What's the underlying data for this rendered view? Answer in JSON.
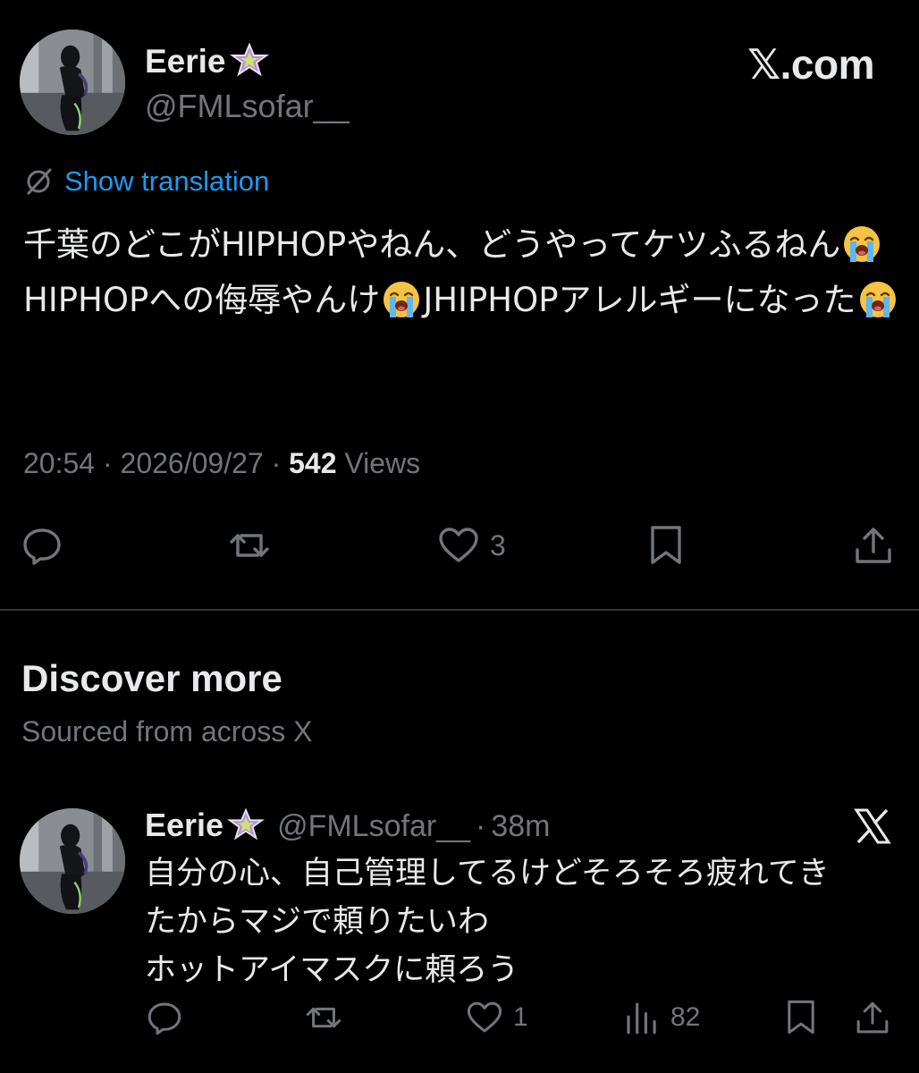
{
  "post": {
    "author": {
      "display_name": "Eerie",
      "handle": "@FMLsofar__",
      "badge_icon": "star-icon"
    },
    "brand_watermark": "𝕏.com",
    "translate": {
      "icon": "no-translation-icon",
      "label": "Show translation"
    },
    "text_segments": [
      {
        "text": "千葉のどこがHIPHOPやねん、どうやってケツふるねん"
      },
      {
        "emoji": "loudly-crying-face"
      },
      {
        "text": "HIPHOPへの侮辱やんけ"
      },
      {
        "emoji": "loudly-crying-face"
      },
      {
        "text": "JHIPHOPアレルギーになった"
      },
      {
        "emoji": "loudly-crying-face"
      }
    ],
    "time": "20:54",
    "date": "2026/09/27",
    "separator": "·",
    "views_count": "542",
    "views_label": "Views",
    "actions": {
      "reply": {
        "icon": "reply-icon"
      },
      "repost": {
        "icon": "repost-icon"
      },
      "like": {
        "icon": "heart-icon",
        "count": "3"
      },
      "bookmark": {
        "icon": "bookmark-icon"
      },
      "share": {
        "icon": "share-icon"
      }
    }
  },
  "discover": {
    "title": "Discover more",
    "subtitle": "Sourced from across X"
  },
  "recommended_post": {
    "author": {
      "display_name": "Eerie",
      "handle": "@FMLsofar__",
      "badge_icon": "star-icon"
    },
    "separator": "·",
    "time": "38m",
    "lines": [
      "自分の心、自己管理してるけどそろそろ疲れてき",
      "たからマジで頼りたいわ",
      "ホットアイマスクに頼ろう"
    ],
    "actions": {
      "reply": {
        "icon": "reply-icon"
      },
      "repost": {
        "icon": "repost-icon"
      },
      "like": {
        "icon": "heart-icon",
        "count": "1"
      },
      "views": {
        "icon": "bar-chart-icon",
        "count": "82"
      },
      "bookmark": {
        "icon": "bookmark-icon"
      },
      "share": {
        "icon": "share-icon"
      }
    }
  },
  "colors": {
    "background": "#000000",
    "text_primary": "#e7e9ea",
    "text_secondary": "#71767b",
    "link": "#1d9bf0",
    "divider": "#2f3336"
  }
}
